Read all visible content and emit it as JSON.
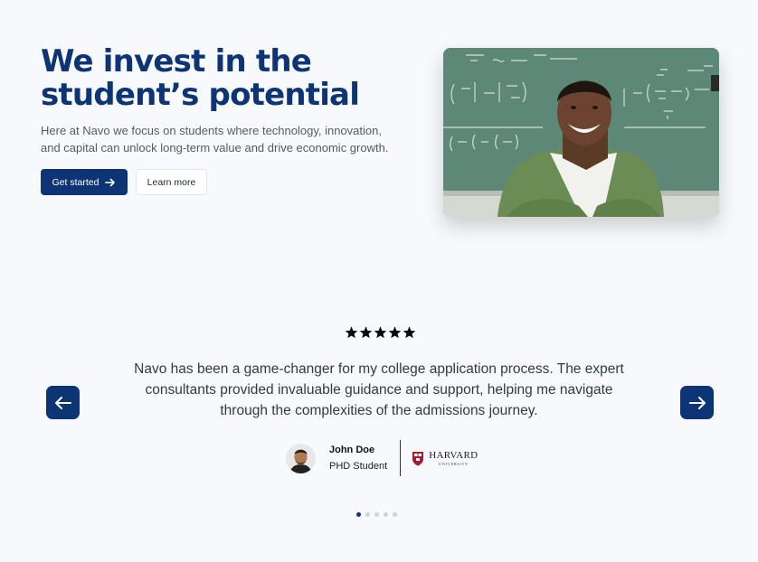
{
  "hero": {
    "title_line1": "We invest in the",
    "title_line2": "student’s potential",
    "description": "Here at Navo we focus on students where technology, innovation, and capital can unlock long-term value and drive economic growth.",
    "primary_button": "Get started",
    "secondary_button": "Learn more"
  },
  "testimonial": {
    "rating_stars": 5,
    "quote": "Navo has been a game-changer for my college application process. The expert consultants provided invaluable guidance and support, helping me navigate through the complexities of the admissions journey.",
    "author_name": "John Doe",
    "author_role": "PHD Student",
    "university_name": "HARVARD",
    "university_sub": "UNIVERSITY"
  },
  "carousel": {
    "slide_count": 5,
    "active_index": 0
  },
  "colors": {
    "brand": "#0d3475",
    "background": "#f7f9fc"
  },
  "icons": {
    "primary_button": "arrow-right-icon",
    "prev": "arrow-left-icon",
    "next": "arrow-right-icon",
    "star": "star-icon"
  }
}
